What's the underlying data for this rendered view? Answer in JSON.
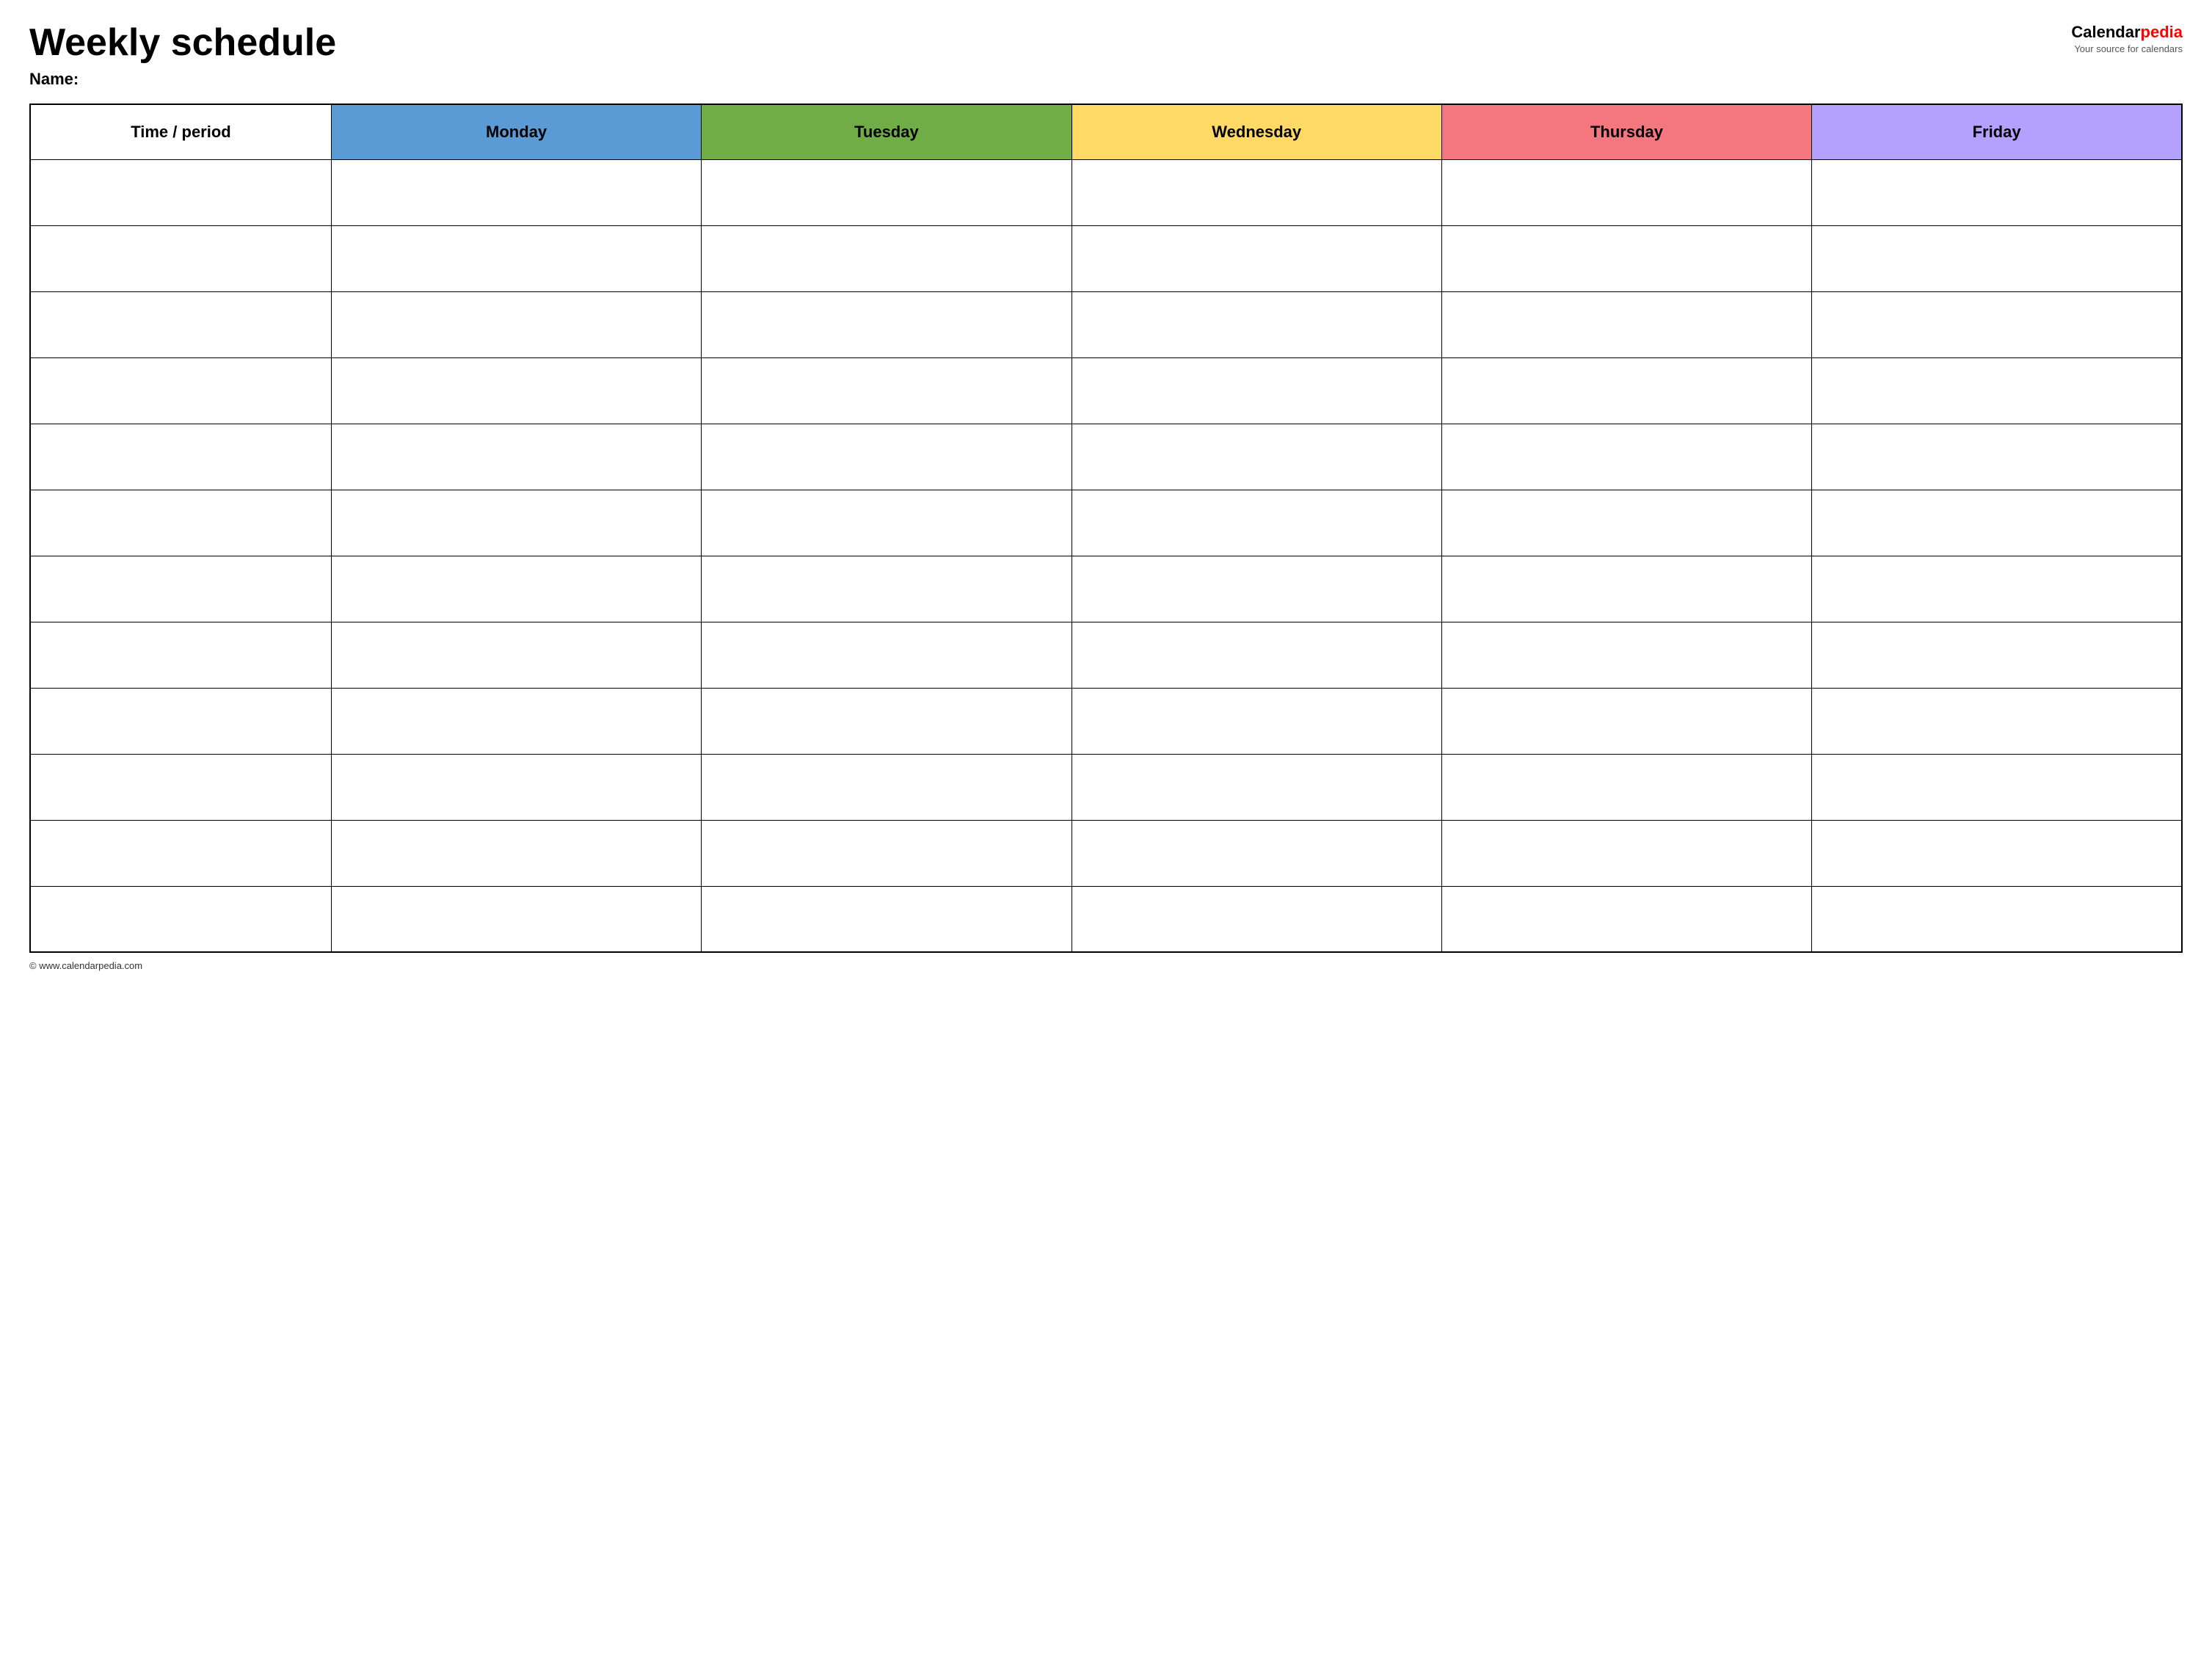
{
  "header": {
    "title": "Weekly schedule",
    "name_label": "Name:",
    "logo": {
      "calendar_text": "Calendar",
      "pedia_text": "pedia",
      "tagline": "Your source for calendars"
    }
  },
  "table": {
    "columns": [
      {
        "key": "time_period",
        "label": "Time / period",
        "color": "#ffffff"
      },
      {
        "key": "monday",
        "label": "Monday",
        "color": "#5b9bd5"
      },
      {
        "key": "tuesday",
        "label": "Tuesday",
        "color": "#70ad47"
      },
      {
        "key": "wednesday",
        "label": "Wednesday",
        "color": "#ffd966"
      },
      {
        "key": "thursday",
        "label": "Thursday",
        "color": "#f4777f"
      },
      {
        "key": "friday",
        "label": "Friday",
        "color": "#b4a0ff"
      }
    ],
    "row_count": 12
  },
  "footer": {
    "copyright": "© www.calendarpedia.com"
  }
}
